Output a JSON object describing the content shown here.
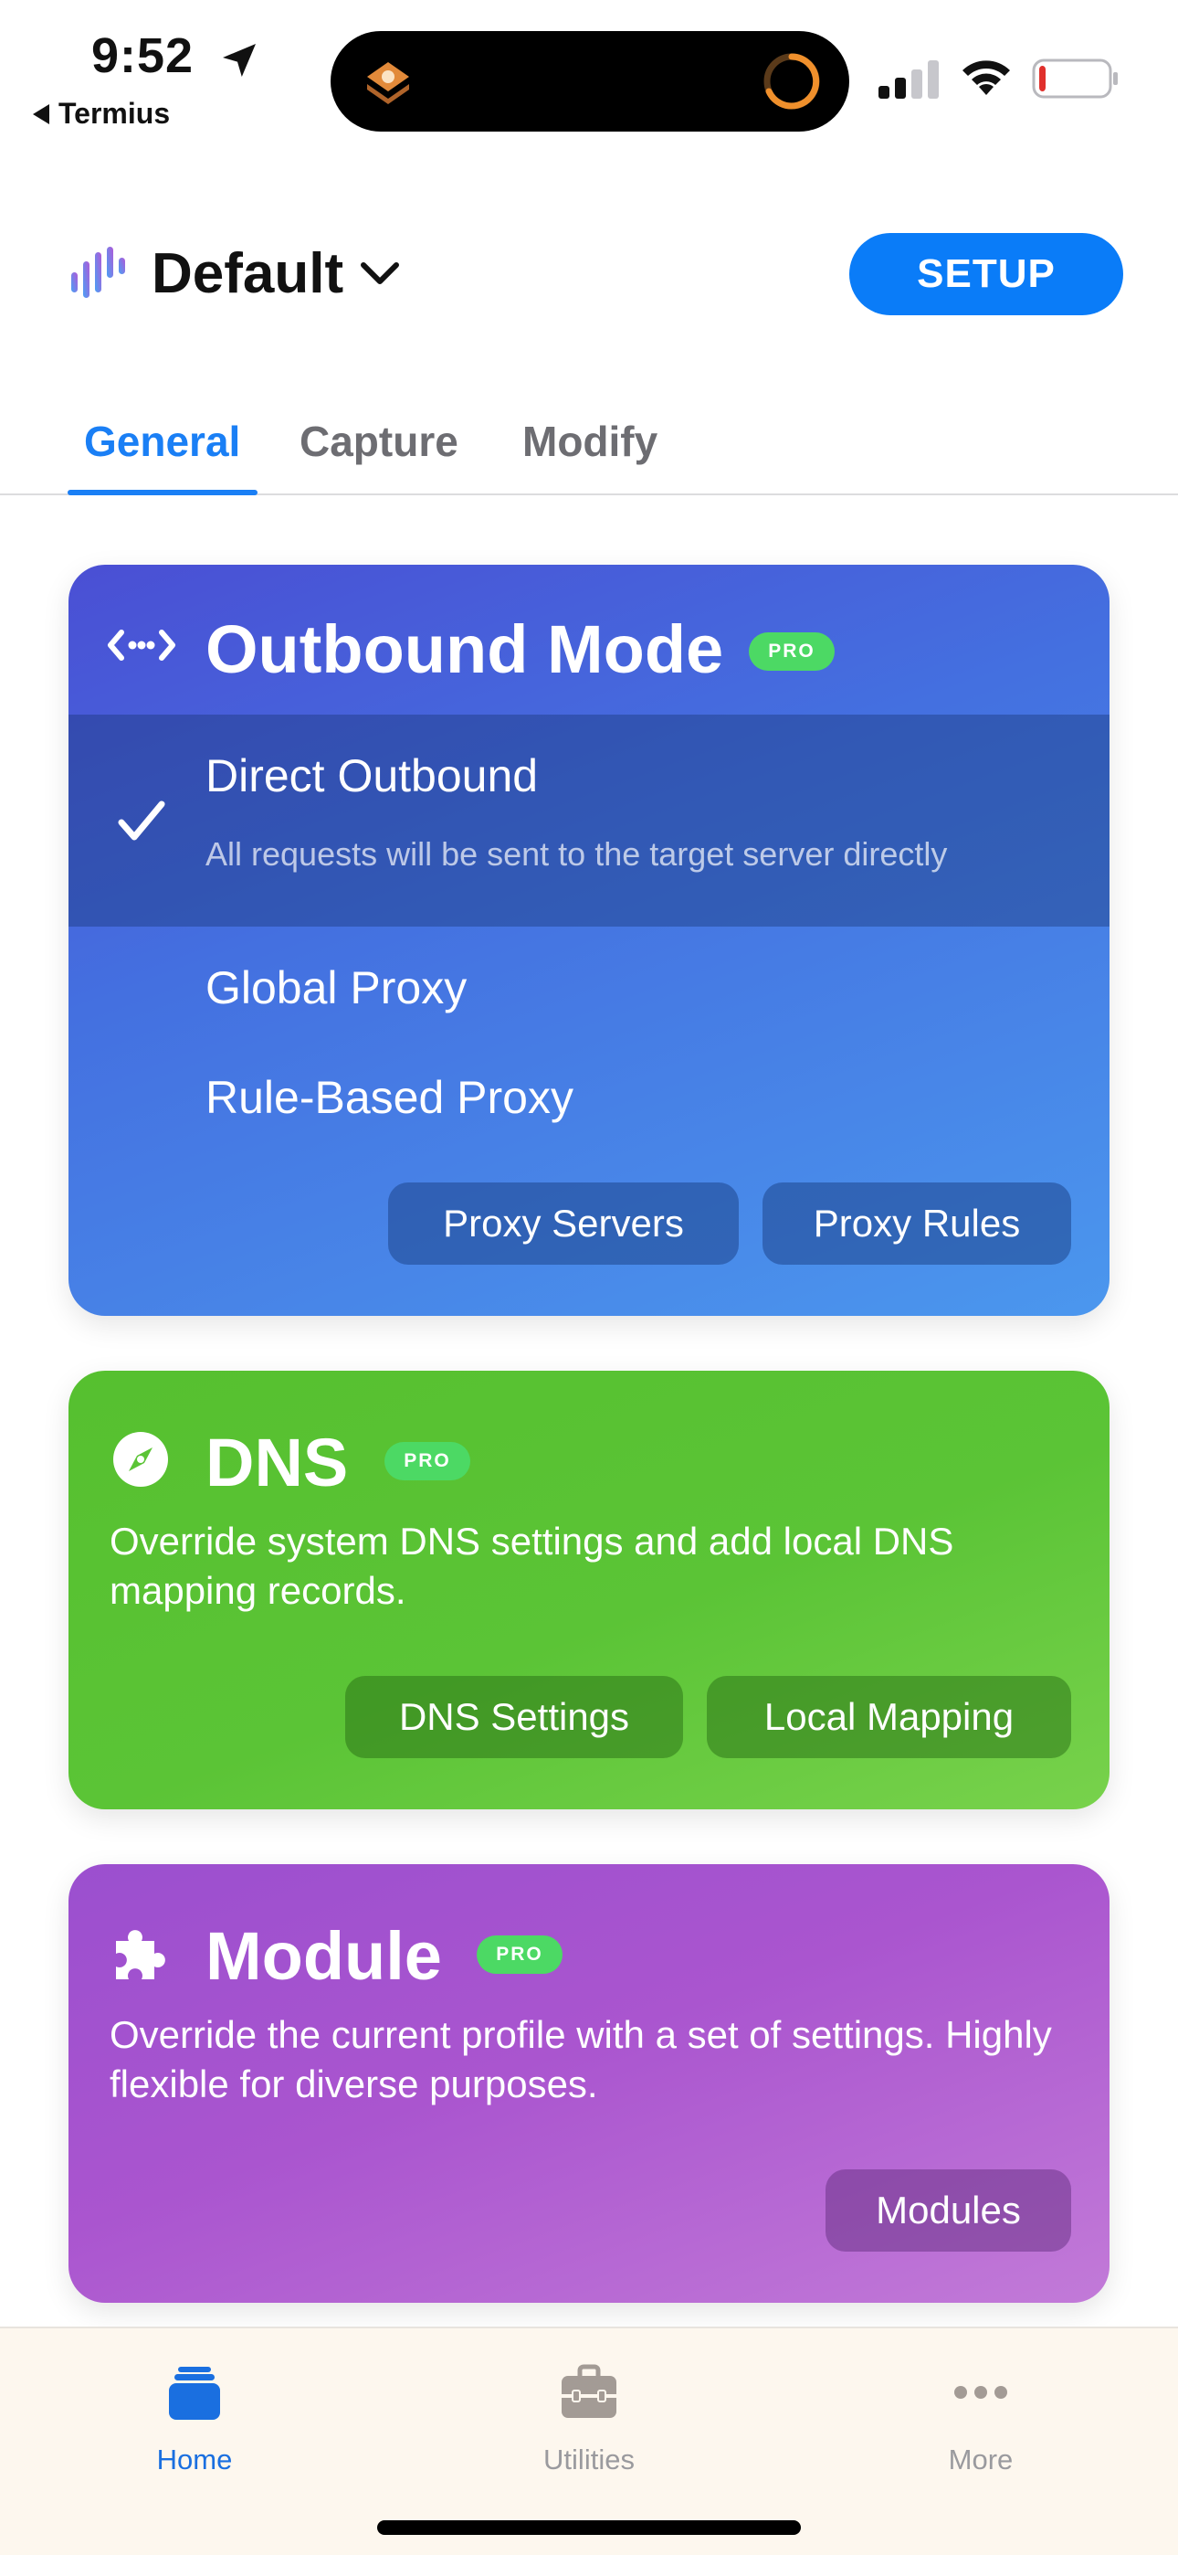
{
  "status_bar": {
    "time": "9:52",
    "back_app": "Termius",
    "battery_level": 0.1,
    "signal_bars": 2,
    "colors": {
      "battery_low": "#e0302c",
      "activity_ring": "#f0902c"
    }
  },
  "header": {
    "profile_name": "Default",
    "setup_label": "SETUP",
    "colors": {
      "accent": "#0a7cf8"
    }
  },
  "tabs": {
    "items": [
      {
        "label": "General",
        "active": true
      },
      {
        "label": "Capture",
        "active": false
      },
      {
        "label": "Modify",
        "active": false
      }
    ]
  },
  "outbound": {
    "title": "Outbound Mode",
    "badge": "PRO",
    "modes": [
      {
        "label": "Direct Outbound",
        "description": "All requests will be sent to the target server directly",
        "selected": true
      },
      {
        "label": "Global Proxy",
        "selected": false
      },
      {
        "label": "Rule-Based Proxy",
        "selected": false
      }
    ],
    "buttons": {
      "proxy_servers": "Proxy Servers",
      "proxy_rules": "Proxy Rules"
    },
    "icon": "code-arrows-icon"
  },
  "dns": {
    "title": "DNS",
    "badge": "PRO",
    "description": "Override system DNS settings and add local DNS mapping records.",
    "buttons": {
      "dns_settings": "DNS Settings",
      "local_mapping": "Local Mapping"
    },
    "icon": "compass-icon"
  },
  "module": {
    "title": "Module",
    "badge": "PRO",
    "description": "Override the current profile with a set of settings. Highly flexible for diverse purposes.",
    "buttons": {
      "modules": "Modules"
    },
    "icon": "puzzle-icon"
  },
  "tabbar": {
    "items": [
      {
        "label": "Home",
        "icon": "stack-icon",
        "active": true
      },
      {
        "label": "Utilities",
        "icon": "toolbox-icon",
        "active": false
      },
      {
        "label": "More",
        "icon": "ellipsis-icon",
        "active": false
      }
    ]
  }
}
